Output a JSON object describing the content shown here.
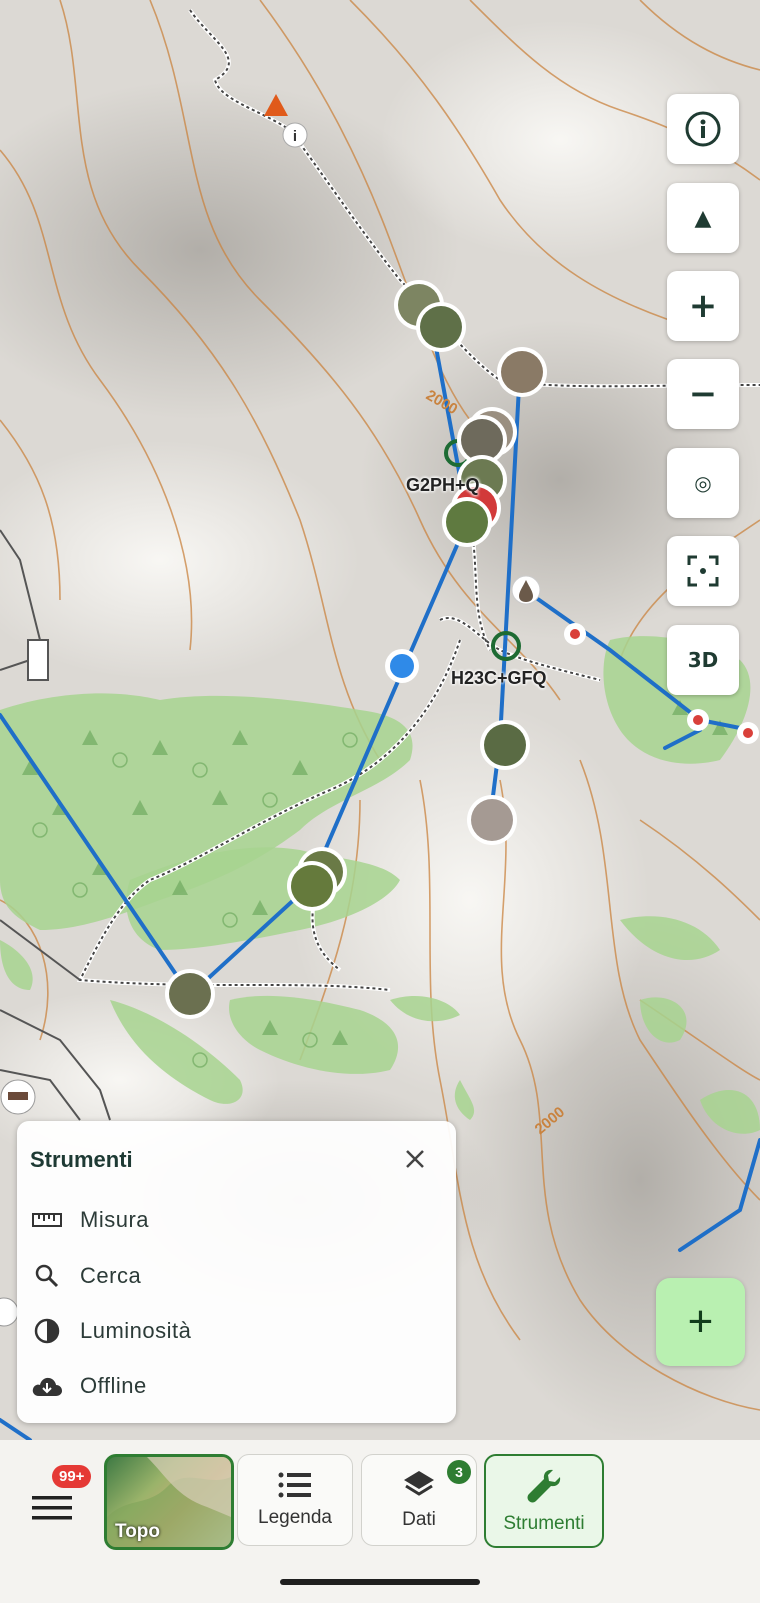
{
  "map": {
    "labels": {
      "plus_code_1": "G2PH+Q",
      "plus_code_2": "H23C+GFQ",
      "elev_1": "2000",
      "elev_2": "2000"
    },
    "colors": {
      "route": "#1f6fc8",
      "forest": "#a7d38f",
      "contour": "#c9833f",
      "user_location": "#2f8ae8",
      "peak_marker": "#e05a1a"
    }
  },
  "controls": {
    "info": "info-icon",
    "compass": "▲",
    "zoom_in": "+",
    "zoom_out": "−",
    "locate": "◎",
    "frame": "frame-icon",
    "three_d": "3D",
    "add": "+"
  },
  "tools_panel": {
    "title": "Strumenti",
    "items": [
      {
        "label": "Misura",
        "icon": "ruler-icon"
      },
      {
        "label": "Cerca",
        "icon": "search-icon"
      },
      {
        "label": "Luminosità",
        "icon": "brightness-icon"
      },
      {
        "label": "Offline",
        "icon": "cloud-download-icon"
      }
    ]
  },
  "bottom_nav": {
    "menu_badge": "99+",
    "topo_label": "Topo",
    "legend_label": "Legenda",
    "data_label": "Dati",
    "data_badge": "3",
    "tools_label": "Strumenti"
  }
}
